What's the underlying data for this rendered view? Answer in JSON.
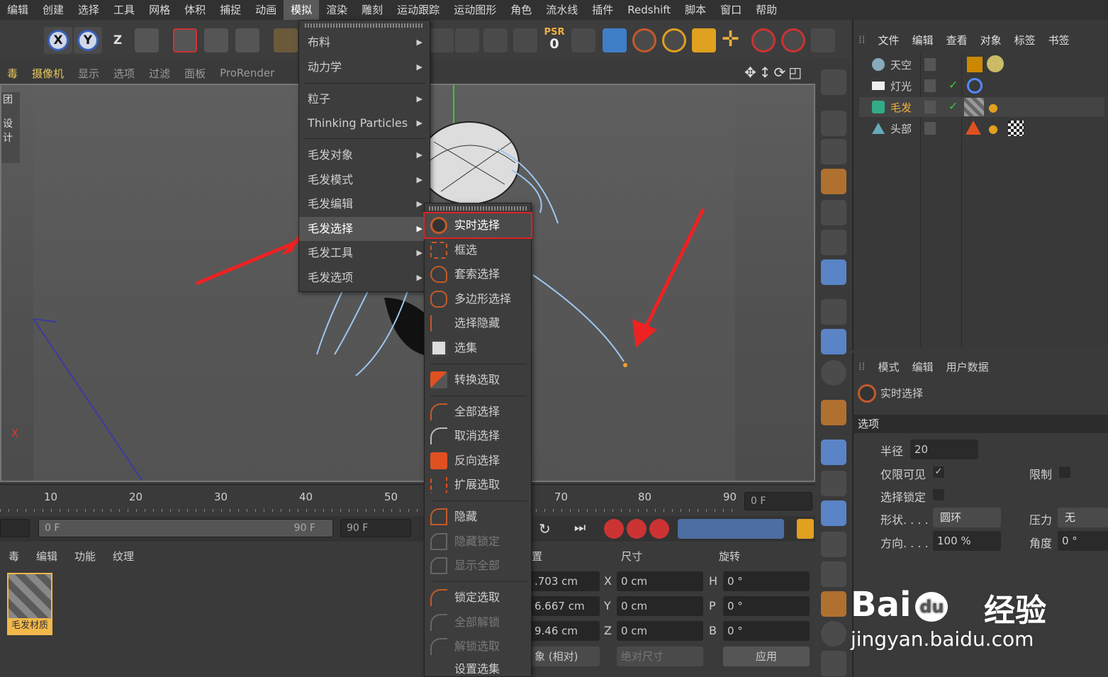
{
  "menubar": [
    "编辑",
    "创建",
    "选择",
    "工具",
    "网格",
    "体积",
    "捕捉",
    "动画",
    "模拟",
    "渲染",
    "雕刻",
    "运动跟踪",
    "运动图形",
    "角色",
    "流水线",
    "插件",
    "Redshift",
    "脚本",
    "窗口",
    "帮助"
  ],
  "toolbar": {
    "x": "X",
    "y": "Y",
    "z": "Z",
    "psr_label": "PSR",
    "psr_value": "0"
  },
  "viewport_menu": [
    "毒",
    "摄像机",
    "显示",
    "选项",
    "过滤",
    "面板",
    "ProRender"
  ],
  "viewport_side": {
    "a": "团",
    "b": "设计"
  },
  "axis_label": "X",
  "simulate_menu": [
    {
      "label": "布料"
    },
    {
      "label": "动力学"
    },
    {
      "label": "粒子"
    },
    {
      "label": "Thinking Particles"
    },
    {
      "label": "毛发对象"
    },
    {
      "label": "毛发模式"
    },
    {
      "label": "毛发编辑"
    },
    {
      "label": "毛发选择"
    },
    {
      "label": "毛发工具"
    },
    {
      "label": "毛发选项"
    }
  ],
  "hair_select_menu": [
    "实时选择",
    "框选",
    "套索选择",
    "多边形选择",
    "选择隐藏",
    "选集",
    "转换选取",
    "全部选择",
    "取消选择",
    "反向选择",
    "扩展选取",
    "隐藏",
    "隐藏锁定",
    "显示全部",
    "锁定选取",
    "全部解锁",
    "解锁选取",
    "设置选集"
  ],
  "timeline": {
    "ticks": [
      "10",
      "20",
      "30",
      "40",
      "50",
      "70",
      "80",
      "90"
    ],
    "frame": "0 F",
    "start": "0 F",
    "end_inner": "90 F",
    "end": "90 F"
  },
  "material_menu": [
    "毒",
    "编辑",
    "功能",
    "纹理"
  ],
  "material": {
    "name": "毛发材质"
  },
  "coords": {
    "col_pos": "置",
    "col_size": "尺寸",
    "col_rot": "旋转",
    "rows": [
      {
        "pos": ".703 cm",
        "axis": "X",
        "size": "0 cm",
        "raxis": "H",
        "rot": "0 °"
      },
      {
        "pos": "6.667 cm",
        "axis": "Y",
        "size": "0 cm",
        "raxis": "P",
        "rot": "0 °"
      },
      {
        "pos": "9.46 cm",
        "axis": "Z",
        "size": "0 cm",
        "raxis": "B",
        "rot": "0 °"
      }
    ],
    "mode": "象 (相对)",
    "size_mode": "绝对尺寸",
    "apply": "应用"
  },
  "object_menu": [
    "文件",
    "编辑",
    "查看",
    "对象",
    "标签",
    "书签"
  ],
  "objects": [
    {
      "name": "天空",
      "color": "#cfcfcf"
    },
    {
      "name": "灯光",
      "color": "#cfcfcf"
    },
    {
      "name": "毛发",
      "color": "#f0b040"
    },
    {
      "name": "头部",
      "color": "#cfcfcf"
    }
  ],
  "attr_menu": [
    "模式",
    "编辑",
    "用户数据"
  ],
  "attr": {
    "title": "实时选择",
    "section": "选项",
    "radius_label": "半径",
    "radius_value": "20",
    "visible_label": "仅限可见",
    "limit_label": "限制",
    "lock_label": "选择锁定",
    "shape_label": "形状. . . .",
    "shape_value": "圆环",
    "pressure_label": "压力",
    "pressure_value": "无",
    "direction_label": "方向. . . .",
    "direction_value": "100 %",
    "angle_label": "角度",
    "angle_value": "0 °",
    "check": "✓"
  },
  "watermark": {
    "brand": "Bai",
    "brand2": "du",
    "cn": "经验",
    "url": "jingyan.baidu.com"
  }
}
